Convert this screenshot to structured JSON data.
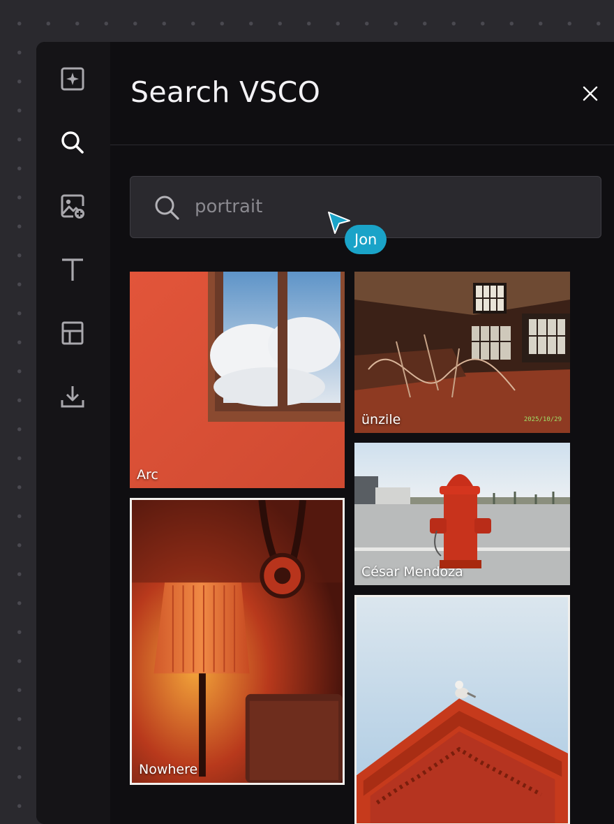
{
  "header": {
    "title": "Search VSCO"
  },
  "rail": {
    "items": [
      {
        "icon": "sparkle-icon"
      },
      {
        "icon": "search-icon"
      },
      {
        "icon": "add-image-icon"
      },
      {
        "icon": "text-icon"
      },
      {
        "icon": "layout-icon"
      },
      {
        "icon": "download-icon"
      }
    ]
  },
  "search": {
    "placeholder": "portrait",
    "icon": "search-icon"
  },
  "collaborator": {
    "name": "Jon",
    "color": "#1aa3c8"
  },
  "results": {
    "items": [
      {
        "author": "Arc"
      },
      {
        "author": "ünzile",
        "stamp": "2025/10/29"
      },
      {
        "author": "César Mendoza"
      },
      {
        "author": "Nowhere",
        "selected": true
      },
      {
        "author": ""
      }
    ]
  },
  "colors": {
    "background": "#2a292e",
    "panel": "#0f0e11",
    "accent": "#1aa3c8"
  }
}
